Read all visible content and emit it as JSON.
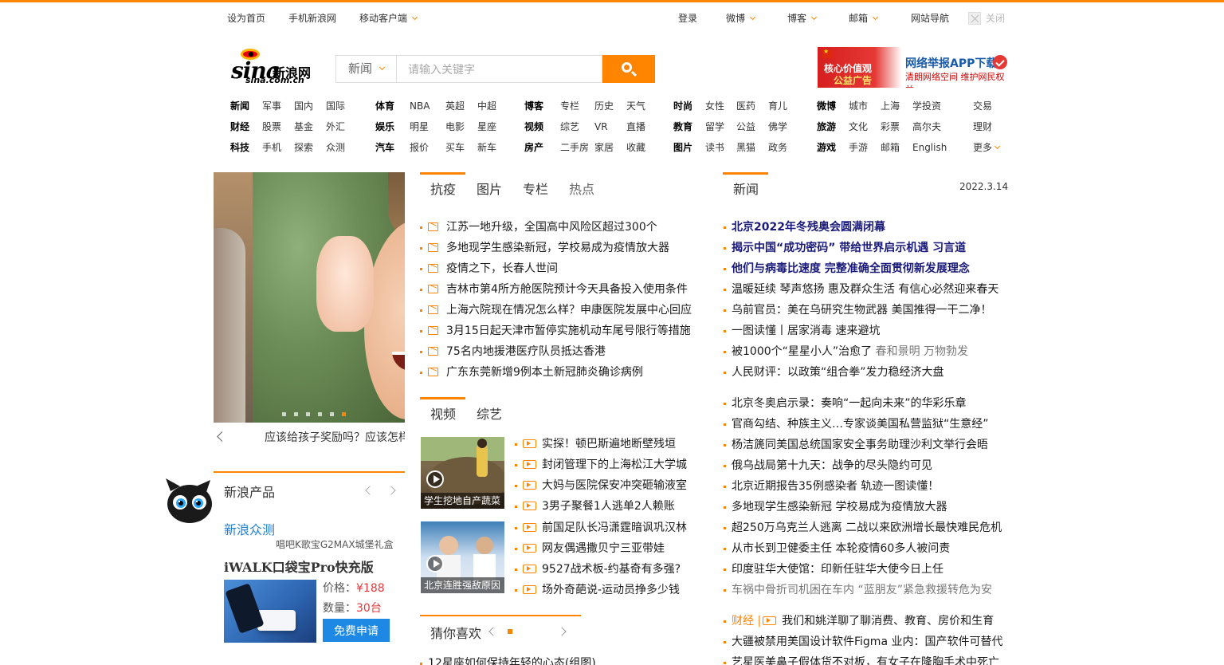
{
  "topbar": {
    "set_home": "设为首页",
    "mobile_news": "手机新浪网",
    "mobile_client": "移动客户端",
    "login": "登录",
    "weibo": "微博",
    "blog": "博客",
    "mail": "邮箱",
    "site_nav": "网站导航",
    "close": "关闭"
  },
  "logo": {
    "brand": "sina",
    "cn": "新浪网",
    "domain": "sina.com.cn"
  },
  "search": {
    "select": "新闻",
    "placeholder": "请输入关键字"
  },
  "ad_banner": {
    "left_line1": "核心价值观",
    "left_line2": "公益广告",
    "right_line1": "网络举报APP下载",
    "right_line2": "清朗网络空间  维护网民权益"
  },
  "nav": {
    "rows": [
      [
        "新闻",
        "军事",
        "国内",
        "国际",
        "体育",
        "NBA",
        "英超",
        "中超",
        "博客",
        "专栏",
        "历史",
        "天气",
        "时尚",
        "女性",
        "医药",
        "育儿",
        "微博",
        "城市",
        "上海",
        "学投资",
        "交易"
      ],
      [
        "财经",
        "股票",
        "基金",
        "外汇",
        "娱乐",
        "明星",
        "电影",
        "星座",
        "视频",
        "综艺",
        "VR",
        "直播",
        "教育",
        "留学",
        "公益",
        "佛学",
        "旅游",
        "文化",
        "彩票",
        "高尔夫",
        "理财"
      ],
      [
        "科技",
        "手机",
        "探索",
        "众测",
        "汽车",
        "报价",
        "买车",
        "新车",
        "房产",
        "二手房",
        "家居",
        "收藏",
        "图片",
        "读书",
        "黑猫",
        "政务",
        "游戏",
        "手游",
        "邮箱",
        "English",
        "更多"
      ]
    ]
  },
  "slideshow": {
    "caption": "应该给孩子奖励吗？应该怎样"
  },
  "products": {
    "title": "新浪产品",
    "zhongce": "新浪众测",
    "ad_line": "唱吧K歌宝G2MAX城堡礼盒",
    "product_name": "iWALK口袋宝Pro快充版",
    "price_label": "价格：",
    "price": "¥188",
    "qty_label": "数量：",
    "qty": "30台",
    "apply": "免费申请"
  },
  "mid_tabs": [
    "抗疫",
    "图片",
    "专栏",
    "热点"
  ],
  "mid_list": [
    "江苏一地升级，全国高中风险区超过300个",
    "多地现学生感染新冠，学校易成为疫情放大器",
    "疫情之下，长春人世间",
    "吉林市第4所方舱医院预计今天具备投入使用条件",
    "上海六院现在情况怎么样？申康医院发展中心回应",
    "3月15日起天津市暂停实施机动车尾号限行等措施",
    "75名内地援港医疗队员抵达香港",
    "广东东莞新增9例本土新冠肺炎确诊病例"
  ],
  "video_tabs": [
    "视频",
    "综艺"
  ],
  "video_thumbs": [
    {
      "caption": "学生挖地自产蔬菜"
    },
    {
      "caption": "北京连胜强敌原因"
    }
  ],
  "video_list": [
    "实探！顿巴斯遍地断壁残垣",
    "封闭管理下的上海松江大学城",
    "大妈与医院保安冲突砸输液室",
    "3男子聚餐1人逃单2人赖账",
    "前国足队长冯潇霆暗讽巩汉林",
    "网友偶遇撒贝宁三亚带娃",
    "9527战术板-约基奇有多强?",
    "场外奇葩说-运动员挣多少钱"
  ],
  "guess": {
    "title": "猜你喜欢",
    "first_item": "12星座如何保持年轻的心态(组图)"
  },
  "right": {
    "tab": "新闻",
    "date": "2022.3.14",
    "headlines": [
      "北京2022年冬残奥会圆满闭幕",
      "揭示中国“成功密码” 带给世界启示机遇 习言道",
      "他们与病毒比速度 完整准确全面贯彻新发展理念"
    ],
    "group1": [
      {
        "text": "温暖延续 琴声悠扬 惠及群众生活 有信心必然迎来春天",
        "grey": ""
      },
      {
        "text": "乌前官员：美在乌研究生物武器 美国推得一干二净！",
        "grey": ""
      },
      {
        "text": "一图读懂丨居家消毒 速来避坑",
        "grey": ""
      },
      {
        "text": "被1000个“星星小人”治愈了 ",
        "grey": "春和景明 万物勃发"
      },
      {
        "text": "人民财评：以政策“组合拳”发力稳经济大盘",
        "grey": ""
      }
    ],
    "group2": [
      "北京冬奥启示录：奏响“一起向未来”的华彩乐章",
      "官商勾结、种族主义…专家谈美国私营监狱“生意经”",
      "杨洁篪同美国总统国家安全事务助理沙利文举行会晤",
      "俄乌战局第十九天：战争的尽头隐约可见",
      "北京近期报告35例感染者 轨迹一图读懂！",
      "多地现学生感染新冠 学校易成为疫情放大器",
      "超250万乌克兰人逃离 二战以来欧洲增长最快难民危机",
      "从市长到卫健委主任 本轮疫情60多人被问责",
      "印度驻华大使馆：印新任驻华大使今日上任",
      "车祸中骨折司机困在车内 “蓝朋友”紧急救援转危为安"
    ],
    "finance_tag": "财经 |",
    "finance_item": "我们和姚洋聊了聊消费、教育、房价和生育",
    "extra": [
      "大疆被禁用美国设计软件Figma 业内：国产软件可替代",
      "艺星医美鼻子假体货不对板，有女子在隆胸手术中死亡"
    ]
  },
  "colors": {
    "accent": "#ff8400",
    "link_blue": "#1f80d6",
    "price_red": "#e4393c",
    "button_blue": "#1e88e5"
  }
}
